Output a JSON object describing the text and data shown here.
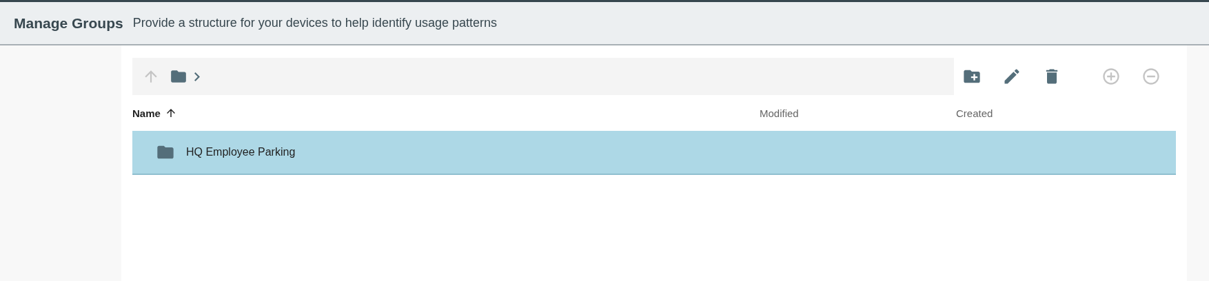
{
  "header": {
    "title": "Manage Groups",
    "subtitle": "Provide a structure for your devices to help identify usage patterns"
  },
  "breadcrumb": {
    "up_disabled": true
  },
  "toolbar": [
    {
      "kind": "new-folder",
      "disabled": false
    },
    {
      "kind": "edit",
      "disabled": false
    },
    {
      "kind": "delete",
      "disabled": false
    },
    {
      "kind": "add",
      "disabled": true
    },
    {
      "kind": "remove",
      "disabled": true
    }
  ],
  "table": {
    "columns": [
      {
        "label": "Name",
        "sorted": true
      },
      {
        "label": "Modified",
        "sorted": false
      },
      {
        "label": "Created",
        "sorted": false
      }
    ],
    "rows": [
      {
        "name": "HQ Employee Parking",
        "selected": true
      }
    ]
  }
}
